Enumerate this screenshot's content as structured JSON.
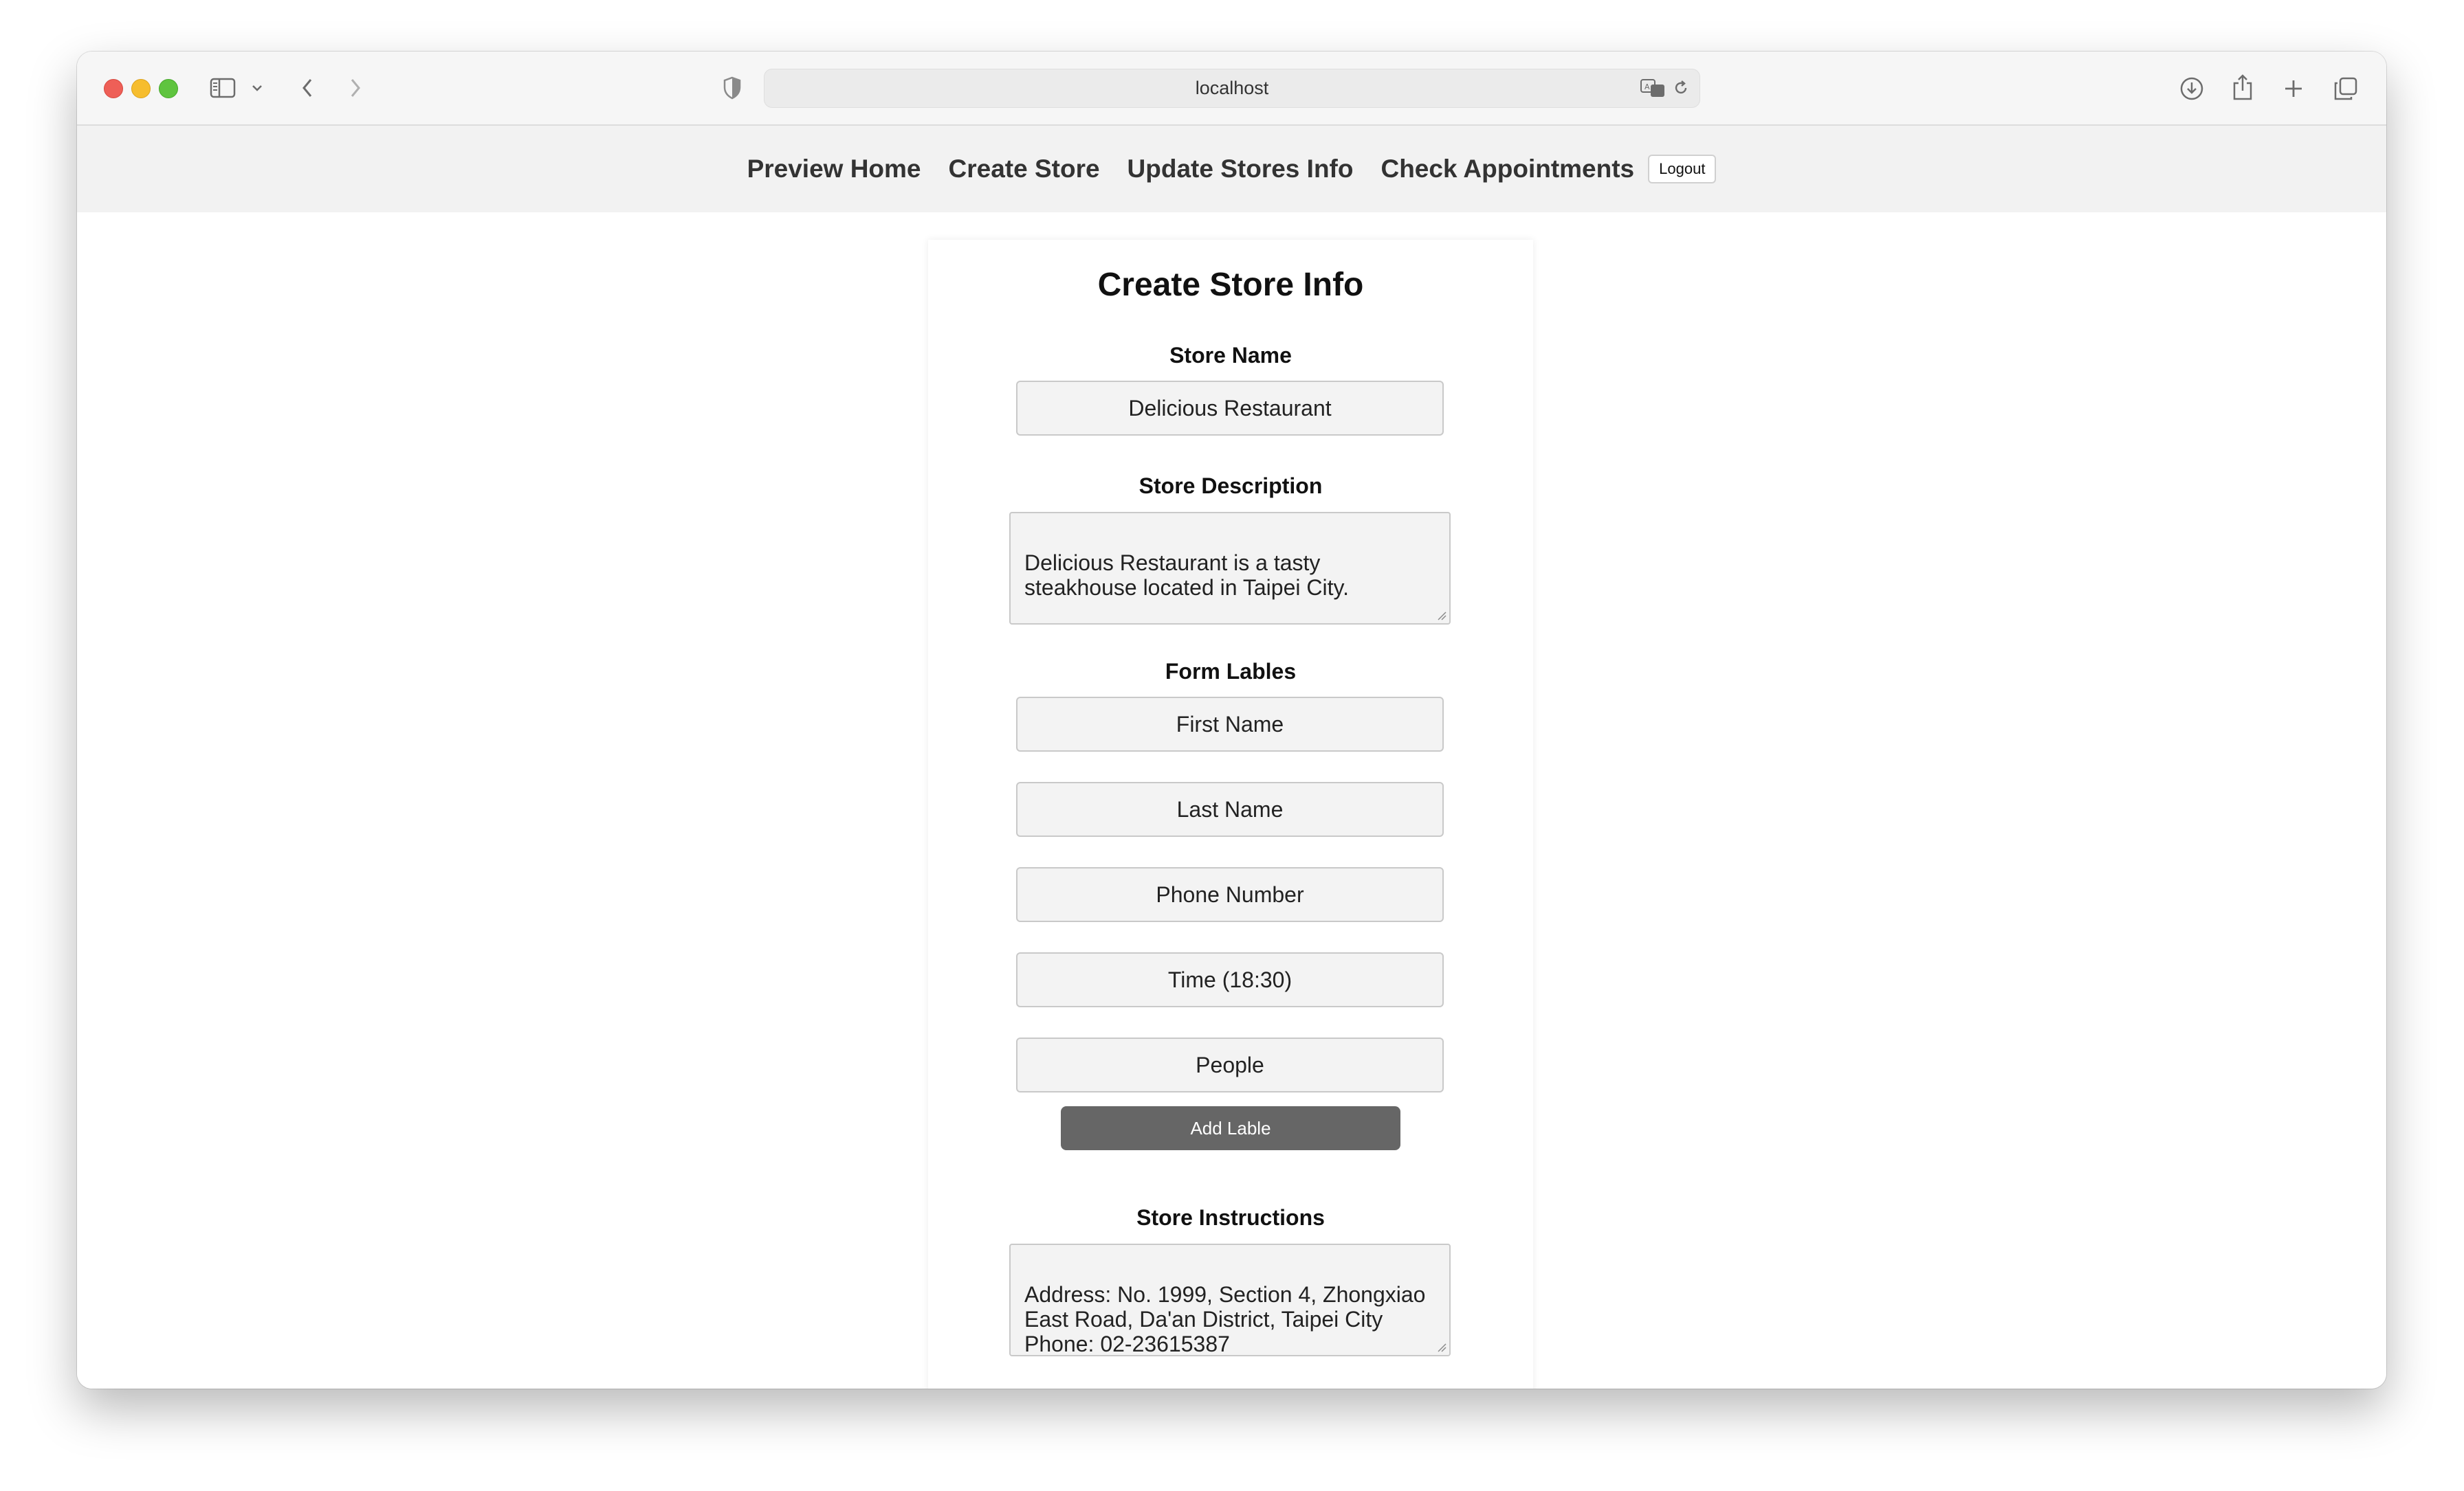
{
  "browser": {
    "url": "localhost"
  },
  "nav": {
    "links": [
      "Preview Home",
      "Create Store",
      "Update Stores Info",
      "Check Appointments"
    ],
    "logout_label": "Logout"
  },
  "form": {
    "title": "Create Store Info",
    "store_name": {
      "label": "Store Name",
      "value": "Delicious Restaurant"
    },
    "store_description": {
      "label": "Store Description",
      "value": "Delicious Restaurant is a tasty\nsteakhouse located in Taipei City."
    },
    "form_labels": {
      "label": "Form Lables",
      "items": [
        "First Name",
        "Last Name",
        "Phone Number",
        "Time (18:30)",
        "People"
      ],
      "add_button": "Add Lable"
    },
    "store_instructions": {
      "label": "Store Instructions",
      "value": "Address: No. 1999, Section 4, Zhongxiao\nEast Road, Da'an District, Taipei City\nPhone: 02-23615387"
    }
  },
  "colors": {
    "nav_background": "#f2f2f2",
    "button_background": "#666666",
    "field_background": "#f3f3f3"
  },
  "icons": [
    "sidebar-icon",
    "chevron-down-icon",
    "back-icon",
    "forward-icon",
    "shield-icon",
    "translate-icon",
    "reload-icon",
    "download-icon",
    "share-icon",
    "new-tab-icon",
    "tabs-overview-icon"
  ]
}
